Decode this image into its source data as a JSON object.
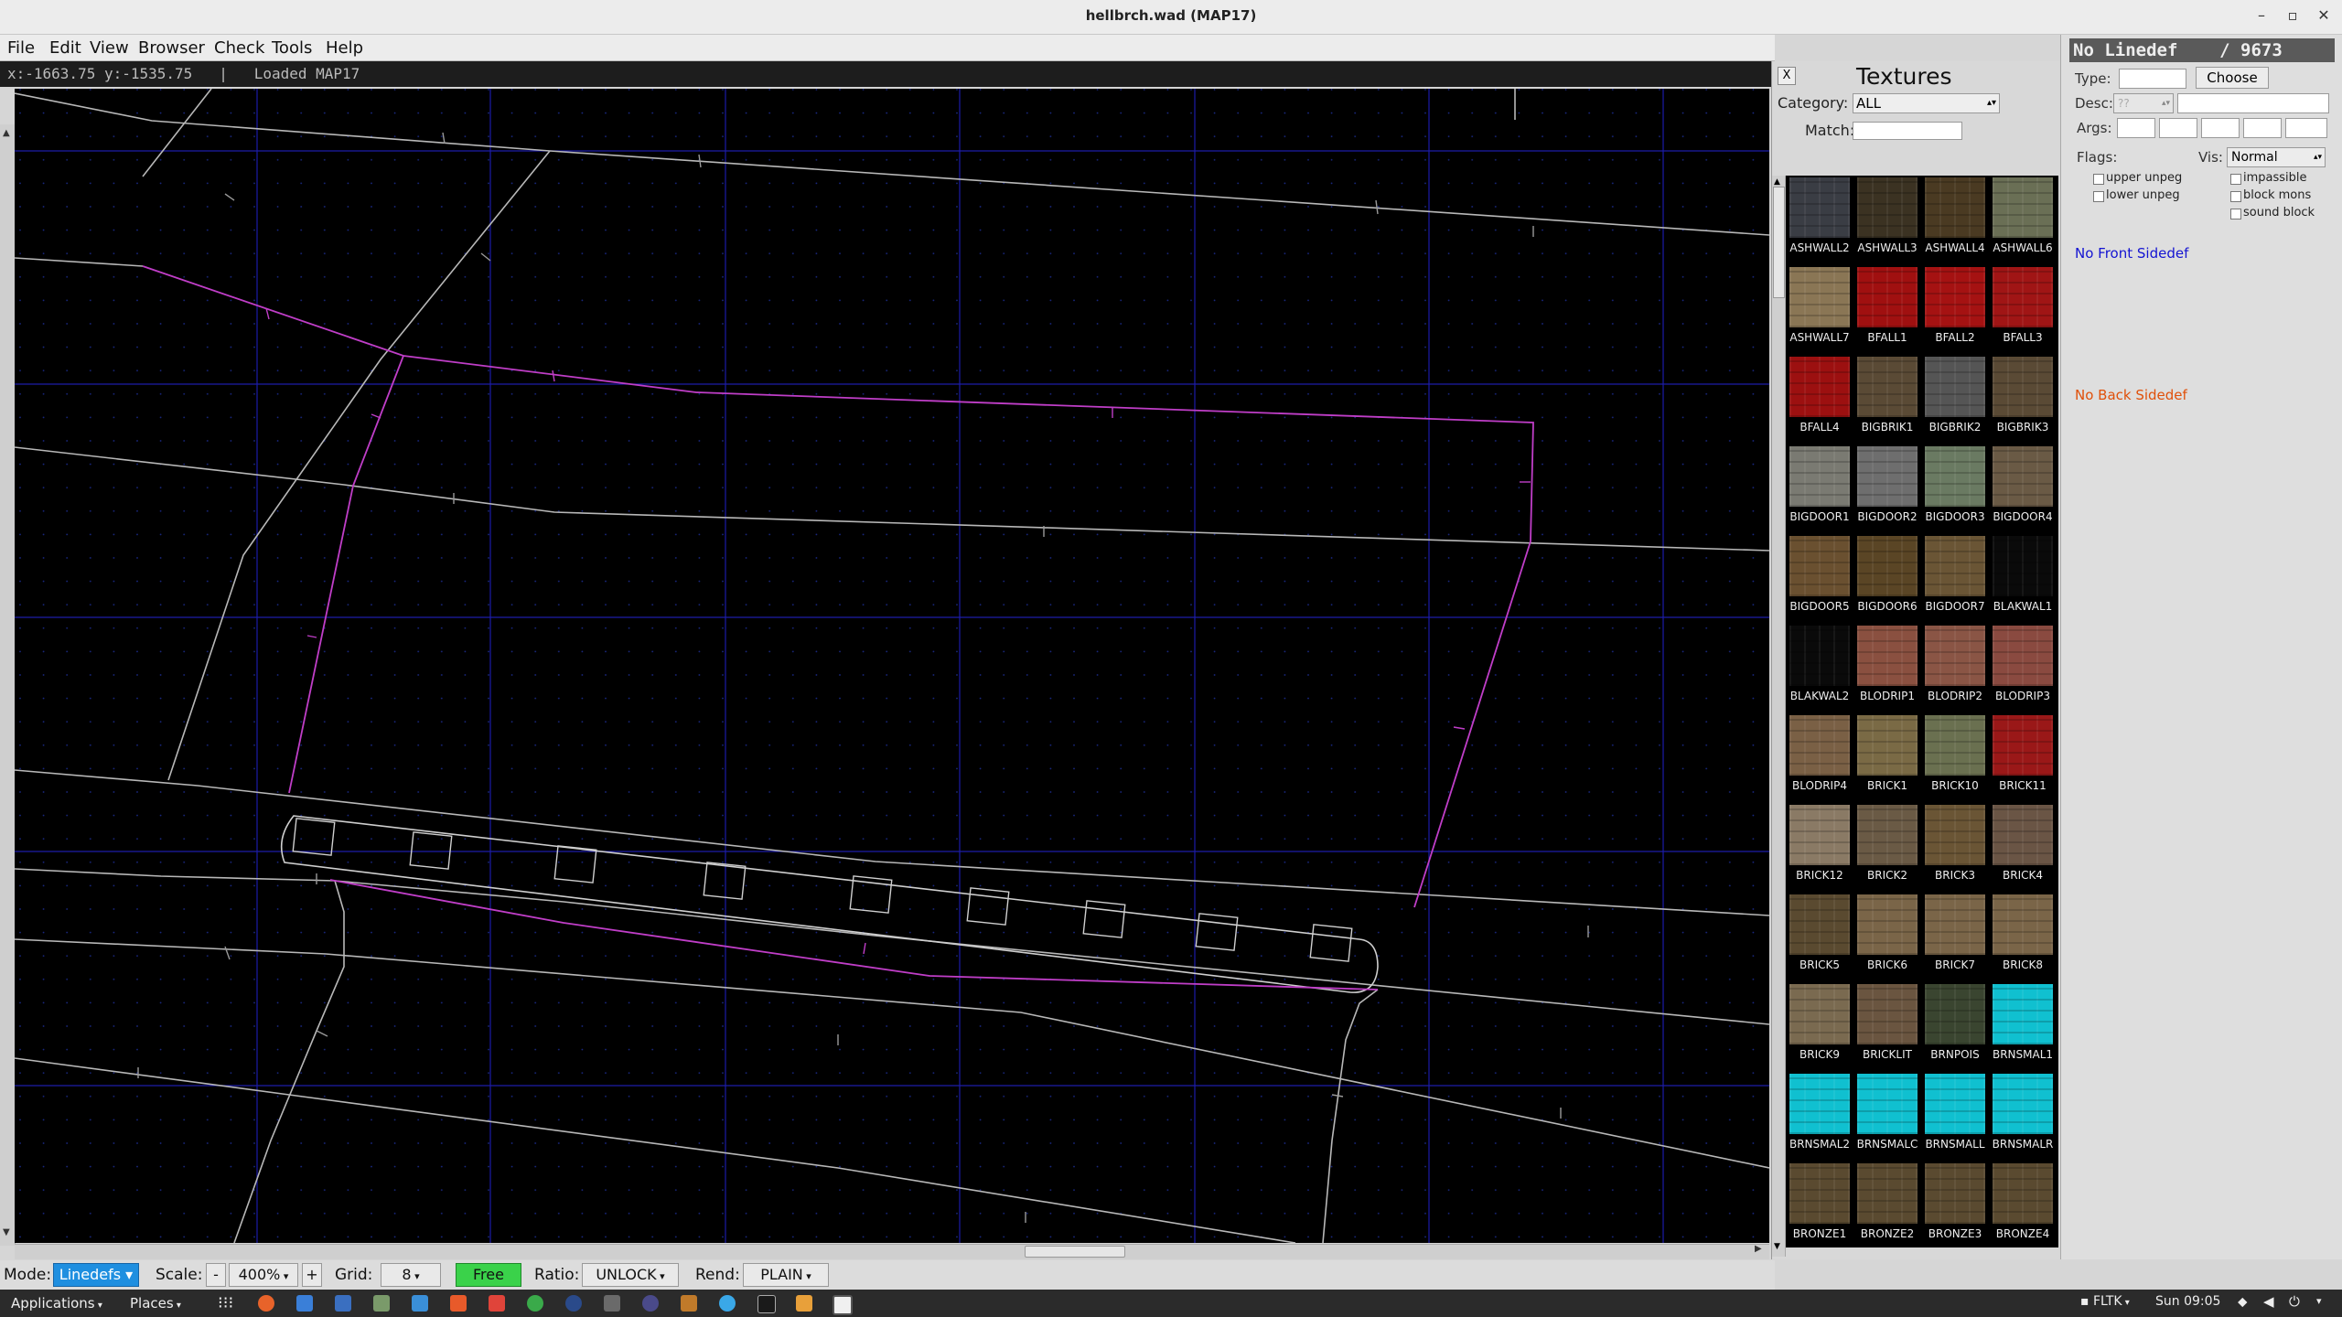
{
  "window": {
    "title": "hellbrch.wad (MAP17)",
    "minimize": "–",
    "maximize": "▫",
    "close": "✕"
  },
  "menu": [
    "File",
    "Edit",
    "View",
    "Browser",
    "Check",
    "Tools",
    "Help"
  ],
  "status_line": "x:-1663.75 y:-1535.75   |   Loaded MAP17",
  "toolbar": {
    "mode_label": "Mode:",
    "mode_value": "Linedefs",
    "scale_label": "Scale:",
    "scale_minus": "-",
    "scale_value": "400%",
    "scale_plus": "+",
    "grid_label": "Grid:",
    "grid_value": "8",
    "free_label": "Free",
    "ratio_label": "Ratio:",
    "ratio_value": "UNLOCK",
    "rend_label": "Rend:",
    "rend_value": "PLAIN"
  },
  "textures_panel": {
    "close": "X",
    "title": "Textures",
    "category_label": "Category:",
    "category_value": "ALL",
    "match_label": "Match:",
    "match_value": "",
    "textures": [
      {
        "name": "ASHWALL2",
        "color": "#3a3d44"
      },
      {
        "name": "ASHWALL3",
        "color": "#3b3222"
      },
      {
        "name": "ASHWALL4",
        "color": "#4a3a22"
      },
      {
        "name": "ASHWALL6",
        "color": "#6a6f55"
      },
      {
        "name": "ASHWALL7",
        "color": "#8a7655"
      },
      {
        "name": "BFALL1",
        "color": "#a01010"
      },
      {
        "name": "BFALL2",
        "color": "#a51212"
      },
      {
        "name": "BFALL3",
        "color": "#a01515"
      },
      {
        "name": "BFALL4",
        "color": "#9c1010"
      },
      {
        "name": "BIGBRIK1",
        "color": "#5a4a35"
      },
      {
        "name": "BIGBRIK2",
        "color": "#555555"
      },
      {
        "name": "BIGBRIK3",
        "color": "#5a4a35"
      },
      {
        "name": "BIGDOOR1",
        "color": "#7a7a72"
      },
      {
        "name": "BIGDOOR2",
        "color": "#6e6e6e"
      },
      {
        "name": "BIGDOOR3",
        "color": "#6a7a62"
      },
      {
        "name": "BIGDOOR4",
        "color": "#6a5a45"
      },
      {
        "name": "BIGDOOR5",
        "color": "#6a5030"
      },
      {
        "name": "BIGDOOR6",
        "color": "#5a4525"
      },
      {
        "name": "BIGDOOR7",
        "color": "#6a5535"
      },
      {
        "name": "BLAKWAL1",
        "color": "#0a0a0a"
      },
      {
        "name": "BLAKWAL2",
        "color": "#0a0a0a"
      },
      {
        "name": "BLODRIP1",
        "color": "#8a5040"
      },
      {
        "name": "BLODRIP2",
        "color": "#8a5545"
      },
      {
        "name": "BLODRIP3",
        "color": "#8a4a40"
      },
      {
        "name": "BLODRIP4",
        "color": "#7a6045"
      },
      {
        "name": "BRICK1",
        "color": "#7a6a45"
      },
      {
        "name": "BRICK10",
        "color": "#6a7050"
      },
      {
        "name": "BRICK11",
        "color": "#9a1818"
      },
      {
        "name": "BRICK12",
        "color": "#8a7a65"
      },
      {
        "name": "BRICK2",
        "color": "#6a5a45"
      },
      {
        "name": "BRICK3",
        "color": "#6a5535"
      },
      {
        "name": "BRICK4",
        "color": "#6a5545"
      },
      {
        "name": "BRICK5",
        "color": "#5a4a30"
      },
      {
        "name": "BRICK6",
        "color": "#7a6548"
      },
      {
        "name": "BRICK7",
        "color": "#7a6548"
      },
      {
        "name": "BRICK8",
        "color": "#7a6548"
      },
      {
        "name": "BRICK9",
        "color": "#7a6a50"
      },
      {
        "name": "BRICKLIT",
        "color": "#6a5540"
      },
      {
        "name": "BRNPOIS",
        "color": "#3a4530"
      },
      {
        "name": "BRNSMAL1",
        "color": "#10c0d0"
      },
      {
        "name": "BRNSMAL2",
        "color": "#10c0d0"
      },
      {
        "name": "BRNSMALC",
        "color": "#10c0d0"
      },
      {
        "name": "BRNSMALL",
        "color": "#10c0d0"
      },
      {
        "name": "BRNSMALR",
        "color": "#10c0d0"
      },
      {
        "name": "BRONZE1",
        "color": "#5a4a30"
      },
      {
        "name": "BRONZE2",
        "color": "#5a4a30"
      },
      {
        "name": "BRONZE3",
        "color": "#5a4a30"
      },
      {
        "name": "BRONZE4",
        "color": "#5a4a30"
      }
    ]
  },
  "linedef_panel": {
    "header": "No Linedef    / 9673",
    "type_label": "Type:",
    "choose_button": "Choose",
    "desc_label": "Desc:",
    "desc_value": "??",
    "args_label": "Args:",
    "flags_label": "Flags:",
    "vis_label": "Vis:",
    "vis_value": "Normal",
    "flags_left": [
      "upper unpeg",
      "lower unpeg"
    ],
    "flags_right": [
      "impassible",
      "block mons",
      "sound block"
    ],
    "front_sidedef": "No Front Sidedef",
    "back_sidedef": "No Back Sidedef",
    "front_color": "#1414d2",
    "back_color": "#e0500a"
  },
  "taskbar": {
    "applications": "Applications",
    "places": "Places",
    "keyboard": "FLTK",
    "clock": "Sun 09:05"
  }
}
